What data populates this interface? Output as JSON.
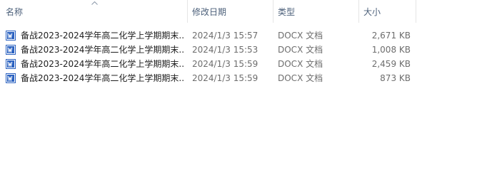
{
  "columns": {
    "name": "名称",
    "modified": "修改日期",
    "type": "类型",
    "size": "大小",
    "sorted_by": "name",
    "sort_icon": "sort-up-icon"
  },
  "files": [
    {
      "name": "备战2023-2024学年高二化学上学期期末...",
      "modified": "2024/1/3 15:57",
      "type": "DOCX 文档",
      "size": "2,671 KB",
      "icon": "word-document-icon"
    },
    {
      "name": "备战2023-2024学年高二化学上学期期末...",
      "modified": "2024/1/3 15:53",
      "type": "DOCX 文档",
      "size": "1,008 KB",
      "icon": "word-document-icon"
    },
    {
      "name": "备战2023-2024学年高二化学上学期期末...",
      "modified": "2024/1/3 15:59",
      "type": "DOCX 文档",
      "size": "2,459 KB",
      "icon": "word-document-icon"
    },
    {
      "name": "备战2023-2024学年高二化学上学期期末...",
      "modified": "2024/1/3 15:59",
      "type": "DOCX 文档",
      "size": "873 KB",
      "icon": "word-document-icon"
    }
  ],
  "colors": {
    "header_text": "#4c607a",
    "secondary_text": "#6d6d6d",
    "word_icon_blue": "#2b62c0"
  }
}
